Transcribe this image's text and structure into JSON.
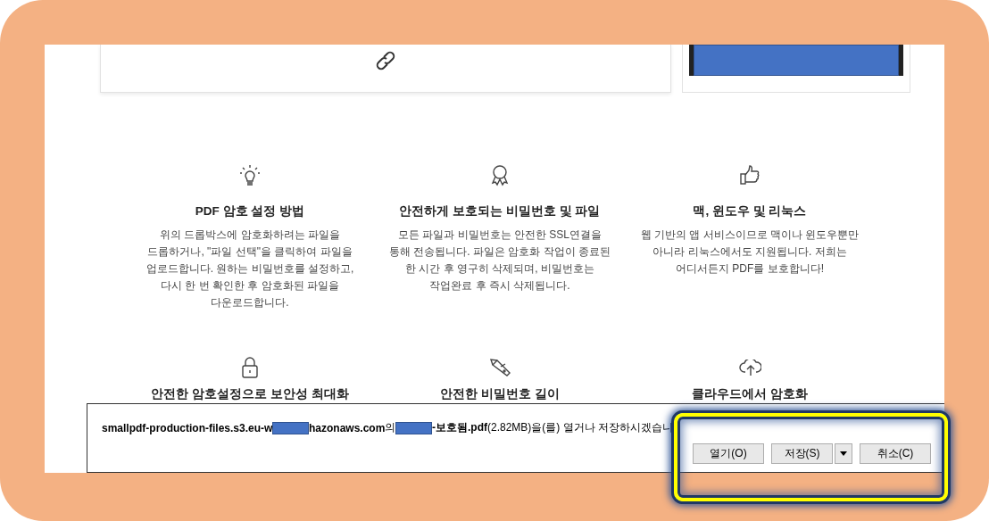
{
  "features": [
    {
      "kind": "bulb",
      "title": "PDF 암호 설정 방법",
      "body": "위의 드롭박스에 암호화하려는 파일을 드롭하거나, \"파일 선택\"을 클릭하여 파일을 업로드합니다. 원하는 비밀번호를 설정하고, 다시 한 번 확인한 후 암호화된 파일을 다운로드합니다."
    },
    {
      "kind": "award",
      "title": "안전하게 보호되는 비밀번호 및 파일",
      "body": "모든 파일과 비밀번호는 안전한 SSL연결을 통해 전송됩니다. 파일은 암호화 작업이 종료된 한 시간 후 영구히 삭제되며, 비밀번호는 작업완료 후 즉시 삭제됩니다."
    },
    {
      "kind": "thumb",
      "title": "맥, 윈도우 및 리눅스",
      "body": "웹 기반의 앱 서비스이므로 맥이나 윈도우뿐만 아니라 리눅스에서도 지원됩니다. 저희는 어디서든지 PDF를 보호합니다!"
    },
    {
      "kind": "lock",
      "title": "안전한 암호설정으로 보안성 최대화"
    },
    {
      "kind": "knife",
      "title": "안전한 비밀번호 길이"
    },
    {
      "kind": "cloud",
      "title": "클라우드에서 암호화"
    }
  ],
  "download_bar": {
    "segments": [
      {
        "kind": "bold",
        "text": "smallpdf-production-files.s3.eu-w"
      },
      {
        "kind": "redacted"
      },
      {
        "kind": "bold",
        "text": "hazonaws.com"
      },
      {
        "kind": "plain",
        "text": "의"
      },
      {
        "kind": "redacted"
      },
      {
        "kind": "bold",
        "text": "-보호됨.pdf"
      },
      {
        "kind": "plain",
        "text": "(2.82MB)을(를) 열거나 저장하시겠습니"
      }
    ],
    "buttons": [
      {
        "label": "열기(O)",
        "dropdown": false
      },
      {
        "label": "저장(S)",
        "dropdown": true
      },
      {
        "label": "취소(C)",
        "dropdown": false
      }
    ]
  }
}
